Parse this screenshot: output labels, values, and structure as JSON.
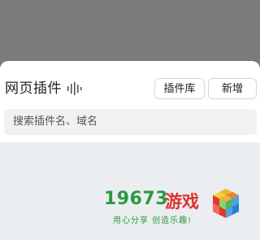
{
  "panel": {
    "title": "网页插件",
    "title_icon": "sound-wave-icon",
    "library_button": "插件库",
    "add_button": "新增"
  },
  "search": {
    "placeholder": "搜索插件名、域名"
  },
  "watermark": {
    "number": "19673",
    "brand": "游戏",
    "slogan": "用心分享 创造乐趣!",
    "colors": {
      "green": "#2b9a3e",
      "red": "#e0312b"
    }
  }
}
